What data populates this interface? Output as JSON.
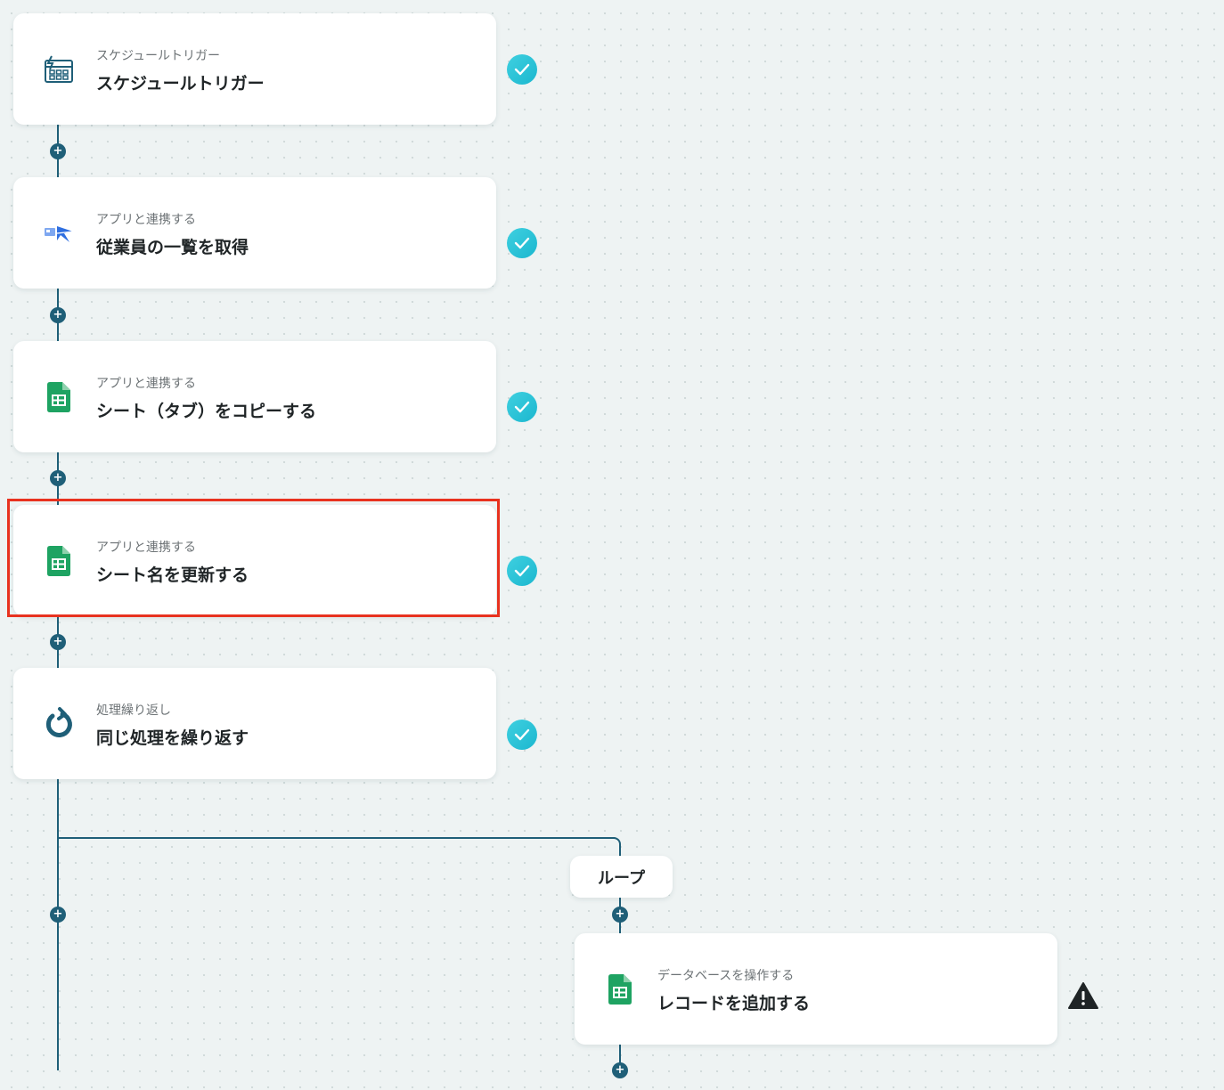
{
  "steps": [
    {
      "subtitle": "スケジュールトリガー",
      "title": "スケジュールトリガー",
      "icon": "schedule-calendar-icon",
      "status": "done"
    },
    {
      "subtitle": "アプリと連携する",
      "title": "従業員の一覧を取得",
      "icon": "hr-app-icon",
      "status": "done"
    },
    {
      "subtitle": "アプリと連携する",
      "title": "シート（タブ）をコピーする",
      "icon": "google-sheets-icon",
      "status": "done"
    },
    {
      "subtitle": "アプリと連携する",
      "title": "シート名を更新する",
      "icon": "google-sheets-icon",
      "status": "done"
    },
    {
      "subtitle": "処理繰り返し",
      "title": "同じ処理を繰り返す",
      "icon": "loop-arrow-icon",
      "status": "done"
    }
  ],
  "loop": {
    "label": "ループ",
    "step": {
      "subtitle": "データベースを操作する",
      "title": "レコードを追加する",
      "icon": "google-sheets-icon",
      "status": "warning"
    }
  },
  "colors": {
    "connector": "#1f5f78",
    "check": "#22c0d6",
    "highlight": "#e8321f",
    "sheets_green": "#1ea362"
  }
}
